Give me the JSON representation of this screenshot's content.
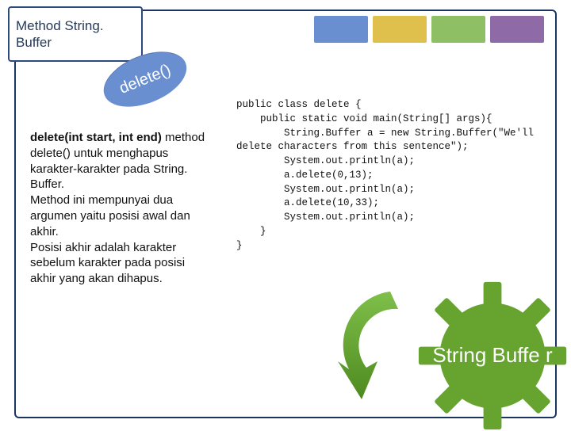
{
  "title": "Method String. Buffer",
  "bubble": "delete()",
  "left": {
    "signature": "delete(int start, int end)",
    "p1": " method delete() untuk menghapus karakter-karakter pada String. Buffer.",
    "p2": "Method ini mempunyai dua argumen yaitu posisi awal dan akhir.",
    "p3": "Posisi akhir adalah karakter sebelum karakter pada posisi akhir yang akan dihapus."
  },
  "code": "public class delete {\n    public static void main(String[] args){\n        String.Buffer a = new String.Buffer(\"We'll\ndelete characters from this sentence\");\n        System.out.println(a);\n        a.delete(0,13);\n        System.out.println(a);\n        a.delete(10,33);\n        System.out.println(a);\n    }\n}",
  "gear_label": "String Buffe r",
  "colors": {
    "navy": "#1c355e",
    "blue": "#6a8fd0",
    "yellow": "#e0c04d",
    "green_tab": "#8fbf65",
    "purple": "#8e6aa6",
    "gear": "#67a32f"
  }
}
